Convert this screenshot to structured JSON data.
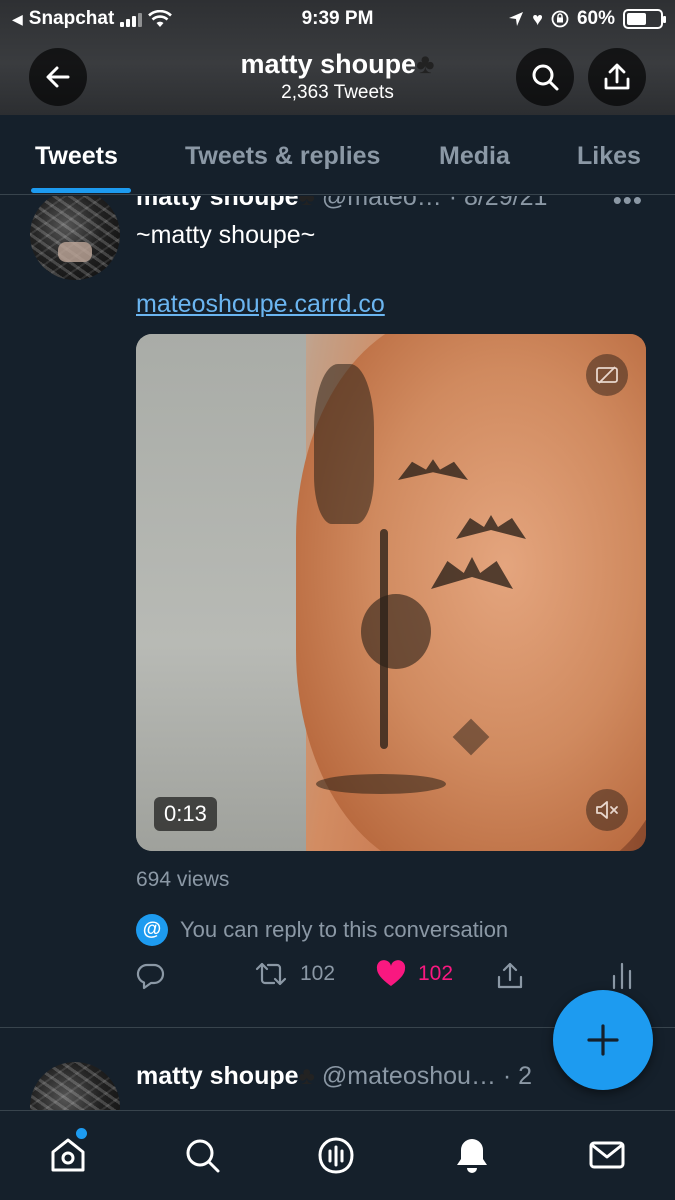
{
  "status_bar": {
    "back_app": "Snapchat",
    "time": "9:39 PM",
    "battery": "60%",
    "battery_level": 0.6
  },
  "header": {
    "title": "matty shoupe",
    "title_emoji": "♣",
    "subtitle": "2,363 Tweets"
  },
  "tabs": [
    {
      "label": "Tweets",
      "active": true
    },
    {
      "label": "Tweets & replies",
      "active": false
    },
    {
      "label": "Media",
      "active": false
    },
    {
      "label": "Likes",
      "active": false
    }
  ],
  "tweet": {
    "name": "matty shoupe",
    "name_emoji": "♣",
    "handle_date": " @mateo… · 8/29/21",
    "text": "~matty shoupe~",
    "link": "mateoshoupe.carrd.co",
    "video_duration": "0:13",
    "views": "694 views",
    "reply_note": "You can reply to this conversation",
    "retweets": "102",
    "likes": "102"
  },
  "next_tweet": {
    "name": "matty shoupe",
    "name_emoji": "♣",
    "handle_date": " @mateoshou… · 2"
  },
  "colors": {
    "background": "#15202b",
    "accent": "#1d9bf0",
    "like": "#f91880",
    "secondary_text": "#8b98a5"
  }
}
